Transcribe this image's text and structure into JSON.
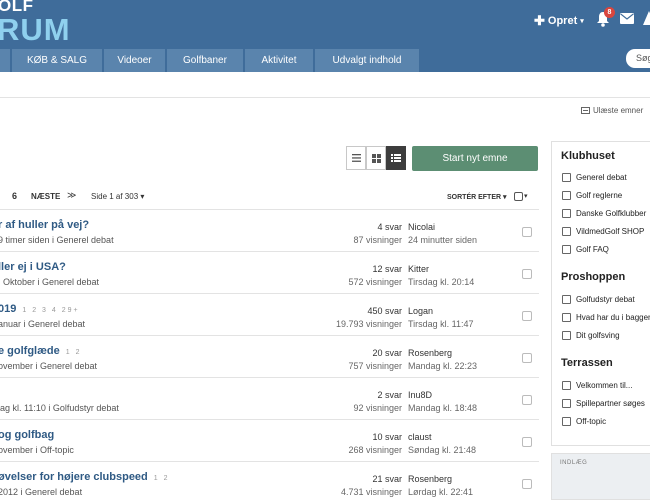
{
  "header": {
    "logo_top": "OLF",
    "logo_bottom": "RUM",
    "create_label": "Opret",
    "notification_count": "8",
    "search_placeholder": "Søg"
  },
  "nav": {
    "tabs": [
      "KØB & SALG",
      "Videoer",
      "Golfbaner",
      "Aktivitet",
      "Udvalgt indhold"
    ]
  },
  "unread_label": "Ulæste emner",
  "toolbar": {
    "start_topic": "Start nyt emne"
  },
  "pagination": {
    "page": "6",
    "next": "NÆSTE",
    "last": "≫",
    "page_info": "Side 1 af 303",
    "sort": "SORTÉR EFTER"
  },
  "topics": [
    {
      "title": "r af huller på vej?",
      "pages": "",
      "meta": "9 timer siden i Generel debat",
      "replies": "4 svar",
      "views": "87 visninger",
      "last_user": "Nicolai",
      "last_time": "24 minutter siden"
    },
    {
      "title": "ller ej i USA?",
      "pages": "",
      "meta": ". Oktober i Generel debat",
      "replies": "12 svar",
      "views": "572 visninger",
      "last_user": "Kitter",
      "last_time": "Tirsdag kl. 20:14"
    },
    {
      "title": "019",
      "pages": "1 2 3 4 29+",
      "meta": "anuar i Generel debat",
      "replies": "450 svar",
      "views": "19.793 visninger",
      "last_user": "Logan",
      "last_time": "Tirsdag kl. 11:47"
    },
    {
      "title": "e golfglæde",
      "pages": "1 2",
      "meta": "ovember i Generel debat",
      "replies": "20 svar",
      "views": "757 visninger",
      "last_user": "Rosenberg",
      "last_time": "Mandag kl. 22:23"
    },
    {
      "title": "",
      "pages": "",
      "meta": "lag kl. 11:10 i Golfudstyr debat",
      "replies": "2 svar",
      "views": "92 visninger",
      "last_user": "Inu8D",
      "last_time": "Mandag kl. 18:48"
    },
    {
      "title": "og golfbag",
      "pages": "",
      "meta": "ovember i Off-topic",
      "replies": "10 svar",
      "views": "268 visninger",
      "last_user": "claust",
      "last_time": "Søndag kl. 21:48"
    },
    {
      "title": "øvelser for højere clubspeed",
      "pages": "1 2",
      "meta": "2012 i Generel debat",
      "replies": "21 svar",
      "views": "4.731 visninger",
      "last_user": "Rosenberg",
      "last_time": "Lørdag kl. 22:41"
    }
  ],
  "sidebar": {
    "sections": [
      {
        "heading": "Klubhuset",
        "items": [
          "Generel debat",
          "Golf reglerne",
          "Danske Golfklubber",
          "VildmedGolf SHOP",
          "Golf FAQ"
        ]
      },
      {
        "heading": "Proshoppen",
        "items": [
          "Golfudstyr debat",
          "Hvad har du i baggen",
          "Dit golfsving"
        ]
      },
      {
        "heading": "Terrassen",
        "items": [
          "Velkommen til...",
          "Spillepartner søges",
          "Off-topic"
        ]
      }
    ],
    "footer_label": "INDLÆG"
  }
}
